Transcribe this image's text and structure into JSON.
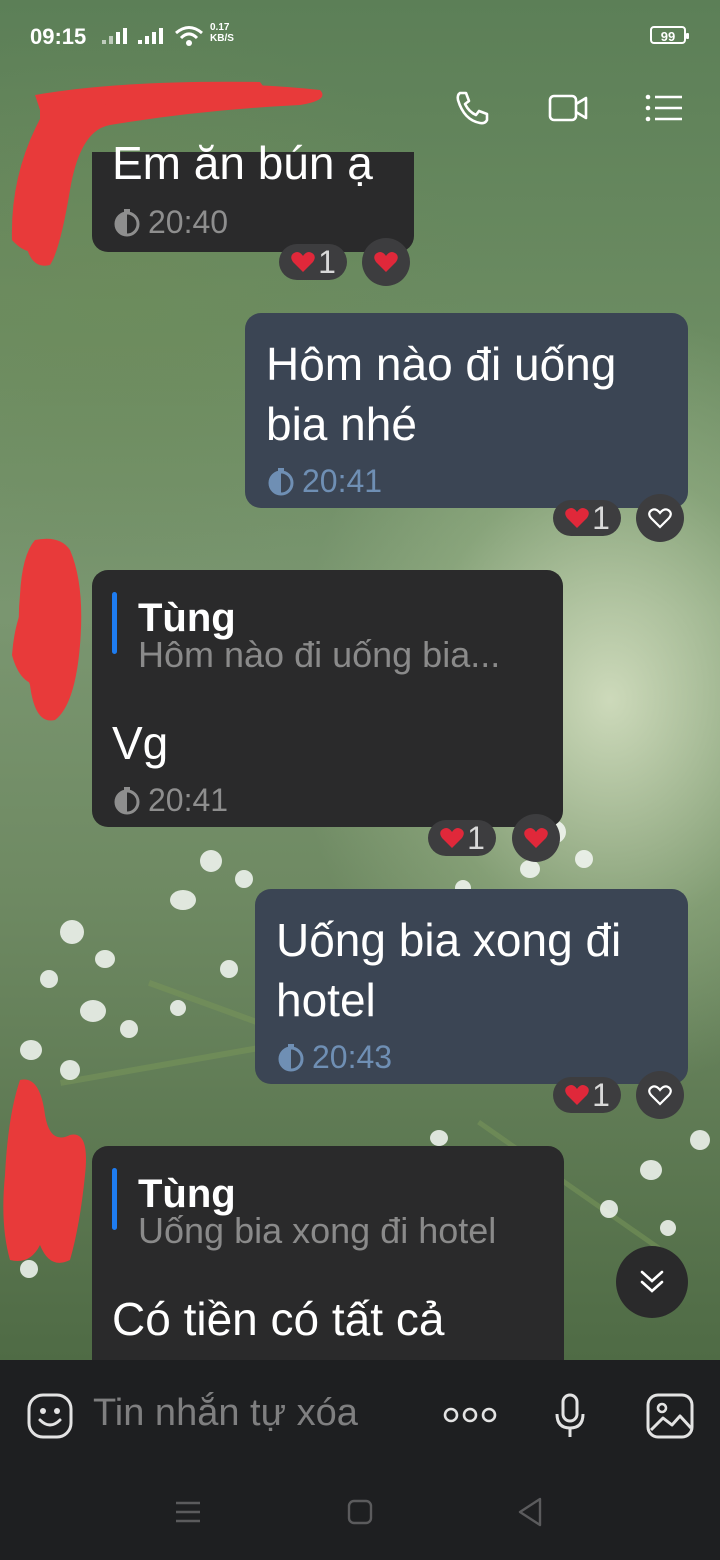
{
  "status_bar": {
    "time": "09:15",
    "net_speed_value": "0.17",
    "net_speed_unit": "KB/S",
    "battery": "99"
  },
  "header": {
    "icons": [
      "phone-icon",
      "video-call-icon",
      "menu-list-icon"
    ]
  },
  "messages": [
    {
      "direction": "in",
      "text": "Em ăn bún ạ",
      "time": "20:40",
      "reaction_count": "1",
      "my_reaction": "heart-filled"
    },
    {
      "direction": "out",
      "text_line1": "Hôm nào đi uống",
      "text_line2": "bia nhé",
      "time": "20:41",
      "reaction_count": "1",
      "my_reaction": "heart-outline"
    },
    {
      "direction": "in",
      "quote_name": "Tùng",
      "quote_text": "Hôm nào đi uống bia...",
      "text": "Vg",
      "time": "20:41",
      "reaction_count": "1",
      "my_reaction": "heart-filled"
    },
    {
      "direction": "out",
      "text_line1": "Uống bia xong đi",
      "text_line2": "hotel",
      "time": "20:43",
      "reaction_count": "1",
      "my_reaction": "heart-outline"
    },
    {
      "direction": "in",
      "quote_name": "Tùng",
      "quote_text": "Uống bia xong đi hotel",
      "text": "Có tiền có tất cả"
    }
  ],
  "composer": {
    "placeholder": "Tin nhắn tự xóa",
    "icons": [
      "emoji-icon",
      "more-options-icon",
      "microphone-icon",
      "image-icon"
    ]
  },
  "nav_bar": {
    "icons": [
      "recents-icon",
      "home-icon",
      "back-icon"
    ]
  },
  "colors": {
    "incoming_bubble": "#2a2a2b",
    "outgoing_bubble": "#3b4554",
    "outgoing_time": "#6f8fb4",
    "quote_accent": "#1e7cf0",
    "heart": "#e0283a"
  }
}
